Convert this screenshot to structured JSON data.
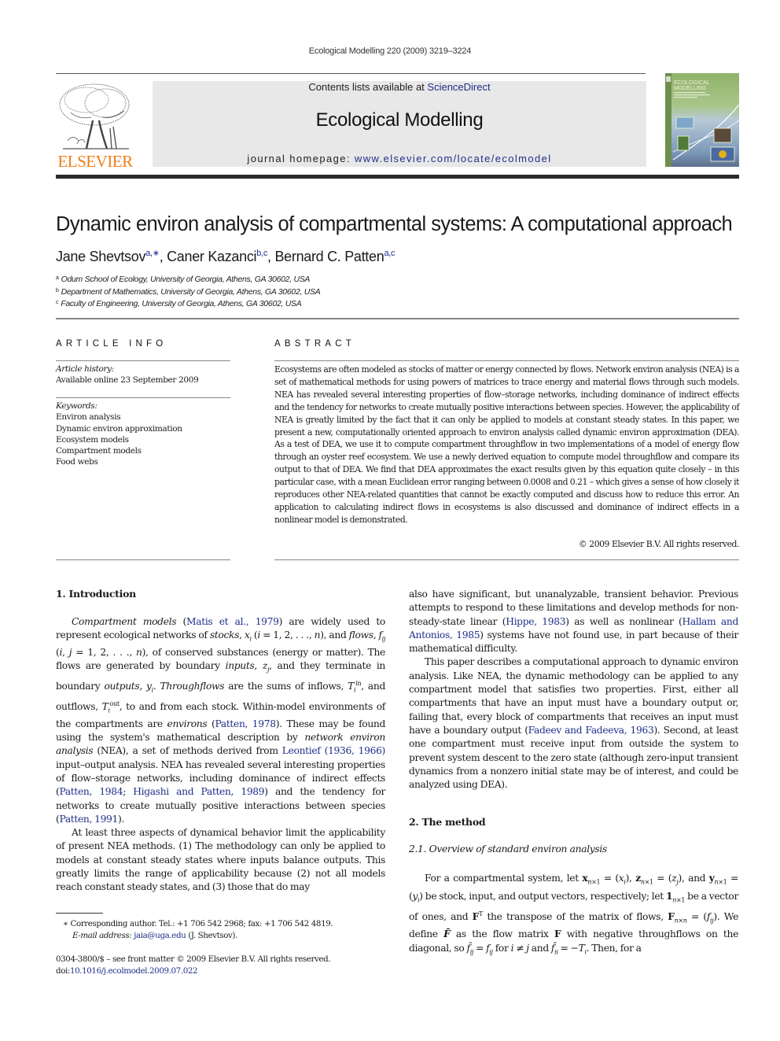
{
  "running_head": "Ecological Modelling 220 (2009) 3219–3224",
  "header": {
    "publisher": "ELSEVIER",
    "contents_prefix": "Contents lists available at ",
    "contents_link": "ScienceDirect",
    "journal_name": "Ecological Modelling",
    "homepage_prefix": "journal homepage: ",
    "homepage_link": "www.elsevier.com/locate/ecolmodel",
    "cover_title_1": "ECOLOGICAL",
    "cover_title_2": "MODELLING",
    "colors": {
      "publisher_orange": "#f07d1a",
      "link_blue": "#1f2f8a",
      "box_gray": "#e8e8e8"
    }
  },
  "article": {
    "title": "Dynamic environ analysis of compartmental systems: A computational approach",
    "authors": [
      {
        "name": "Jane Shevtsov",
        "marks": "a,∗"
      },
      {
        "name": "Caner Kazanci",
        "marks": "b,c"
      },
      {
        "name": "Bernard C. Patten",
        "marks": "a,c"
      }
    ],
    "affiliations": [
      {
        "mark": "a",
        "text": "Odum School of Ecology, University of Georgia, Athens, GA 30602, USA"
      },
      {
        "mark": "b",
        "text": "Department of Mathematics, University of Georgia, Athens, GA 30602, USA"
      },
      {
        "mark": "c",
        "text": "Faculty of Engineering, University of Georgia, Athens, GA 30602, USA"
      }
    ]
  },
  "article_info": {
    "heading": "ARTICLE INFO",
    "history_label": "Article history:",
    "history_value": "Available online 23 September 2009",
    "keywords_label": "Keywords:",
    "keywords": [
      "Environ analysis",
      "Dynamic environ approximation",
      "Ecosystem models",
      "Compartment models",
      "Food webs"
    ]
  },
  "abstract": {
    "heading": "ABSTRACT",
    "text": "Ecosystems are often modeled as stocks of matter or energy connected by flows. Network environ analysis (NEA) is a set of mathematical methods for using powers of matrices to trace energy and material flows through such models. NEA has revealed several interesting properties of flow–storage networks, including dominance of indirect effects and the tendency for networks to create mutually positive interactions between species. However, the applicability of NEA is greatly limited by the fact that it can only be applied to models at constant steady states. In this paper, we present a new, computationally oriented approach to environ analysis called dynamic environ approximation (DEA). As a test of DEA, we use it to compute compartment throughflow in two implementations of a model of energy flow through an oyster reef ecosystem. We use a newly derived equation to compute model throughflow and compare its output to that of DEA. We find that DEA approximates the exact results given by this equation quite closely – in this particular case, with a mean Euclidean error ranging between 0.0008 and 0.21 – which gives a sense of how closely it reproduces other NEA-related quantities that cannot be exactly computed and discuss how to reduce this error. An application to calculating indirect flows in ecosystems is also discussed and dominance of indirect effects in a nonlinear model is demonstrated.",
    "copyright": "© 2009 Elsevier B.V. All rights reserved."
  },
  "sections": {
    "s1_title": "1.  Introduction",
    "s2_title": "2.  The method",
    "s21_title": "2.1.  Overview of standard environ analysis"
  },
  "citations": {
    "matis": "Matis et al., 1979",
    "patten1978": "Patten, 1978",
    "leontief": "Leontief (1936, 1966)",
    "patten1984": "Patten, 1984",
    "higashi": "Higashi and Patten, 1989",
    "patten1991": "Patten, 1991",
    "hippe": "Hippe, 1983",
    "hallam": "Hallam and Antonios, 1985",
    "fadeev": "Fadeev and Fadeeva, 1963"
  },
  "footnotes": {
    "corresponding": "∗   Corresponding author. Tel.: +1 706 542 2968; fax: +1 706 542 4819.",
    "email_label": "E-mail address: ",
    "email": "jaia@uga.edu",
    "email_suffix": " (J. Shevtsov).",
    "issn_line": "0304-3800/$ – see front matter © 2009 Elsevier B.V. All rights reserved.",
    "doi_prefix": "doi:",
    "doi": "10.1016/j.ecolmodel.2009.07.022"
  }
}
